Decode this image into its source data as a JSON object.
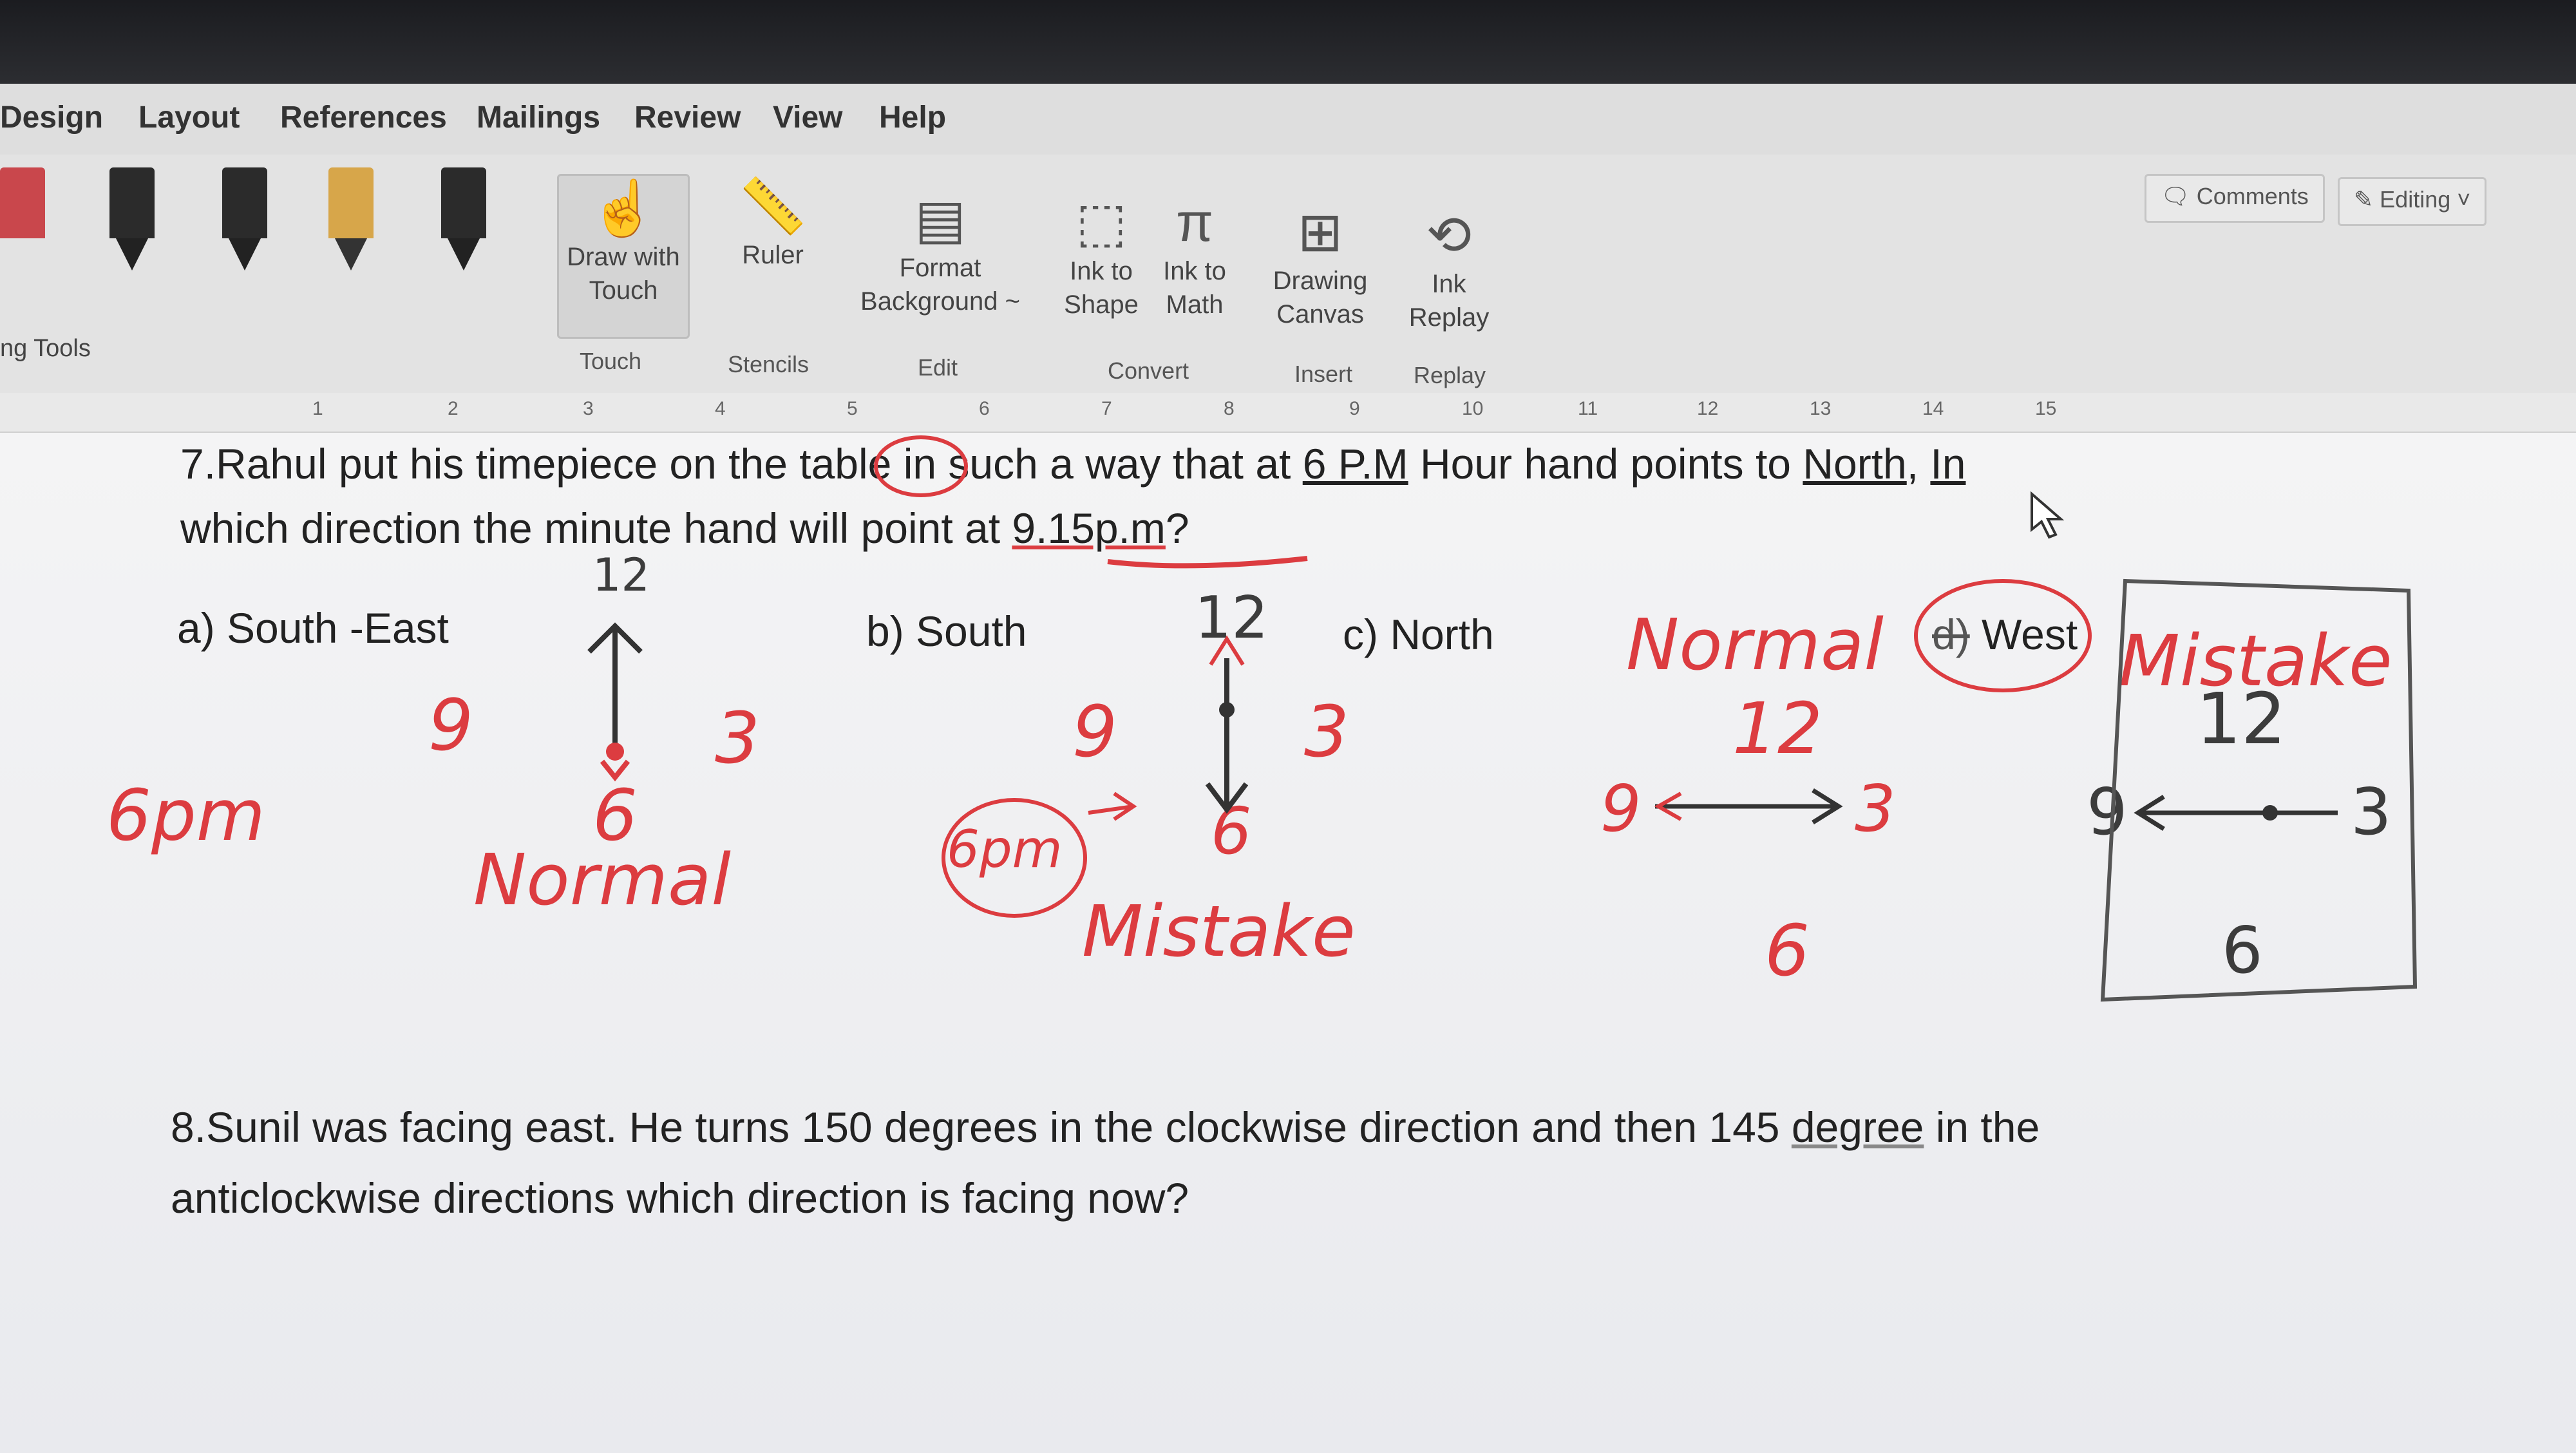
{
  "menu_tabs": [
    "Design",
    "Layout",
    "References",
    "Mailings",
    "Review",
    "View",
    "Help"
  ],
  "ribbon": {
    "tools_label": "ng Tools",
    "draw_with_touch": {
      "line1": "Draw with",
      "line2": "Touch"
    },
    "ruler": "Ruler",
    "format_background": {
      "line1": "Format",
      "line2": "Background ~"
    },
    "ink_to_shape": {
      "line1": "Ink to",
      "line2": "Shape"
    },
    "ink_to_math": {
      "line1": "Ink to",
      "line2": "Math"
    },
    "drawing_canvas": {
      "line1": "Drawing",
      "line2": "Canvas"
    },
    "ink_replay": {
      "line1": "Ink",
      "line2": "Replay"
    },
    "groups": {
      "touch": "Touch",
      "stencils": "Stencils",
      "edit": "Edit",
      "convert": "Convert",
      "insert": "Insert",
      "replay": "Replay"
    },
    "comments": "Comments",
    "editing": "Editing ˅",
    "icons": {
      "touch": "hand-pointer-icon",
      "ruler": "ruler-icon",
      "background": "format-background-icon",
      "shape": "ink-to-shape-icon",
      "math": "ink-to-math-icon",
      "canvas": "drawing-canvas-icon",
      "replay": "ink-replay-icon"
    }
  },
  "ruler_numbers": [
    "1",
    "2",
    "3",
    "4",
    "5",
    "6",
    "7",
    "8",
    "9",
    "10",
    "11",
    "12",
    "13",
    "14",
    "15"
  ],
  "question7": {
    "line1_a": "7.Rahul put his timepiece on the ",
    "line1_b": "table",
    "line1_c": " in such a way that at ",
    "line1_d": "6 P.M",
    "line1_e": " Hour hand points to ",
    "line1_f": "North",
    "line1_g": ", ",
    "line1_h": "In",
    "line2_a": "which direction the minute hand will point at ",
    "line2_b": "9.15p.m",
    "line2_c": "?",
    "options": {
      "a": "a) South -East",
      "b": "b) South",
      "c": "c) North",
      "d_struck": "d)",
      "d": "West"
    }
  },
  "handwriting": {
    "clock1": {
      "n12": "12",
      "n9": "9",
      "n3": "3",
      "n6": "6",
      "label": "6pm",
      "note": "Normal"
    },
    "clock2": {
      "n12": "12",
      "n9": "9",
      "n3": "3",
      "n6": "6",
      "label": "6pm",
      "note": "Mistake"
    },
    "clock3": {
      "n12": "12",
      "n9": "9",
      "n3": "3",
      "n6": "6",
      "note": "Normal"
    },
    "clock4": {
      "n12": "12",
      "n9": "9",
      "n3": "3",
      "n6": "6",
      "note": "Mistake"
    }
  },
  "question8": {
    "line1_a": "8.Sunil was facing east. He turns 150 degrees in the clockwise direction and then 145 ",
    "line1_b": "degree",
    "line1_c": " in the",
    "line2": "anticlockwise directions which direction is facing now?"
  },
  "colors": {
    "ink_red": "#dc3c40",
    "ink_dark": "#3c3c3c",
    "ribbon": "#e3e3e3",
    "page": "#f2f2f3"
  }
}
